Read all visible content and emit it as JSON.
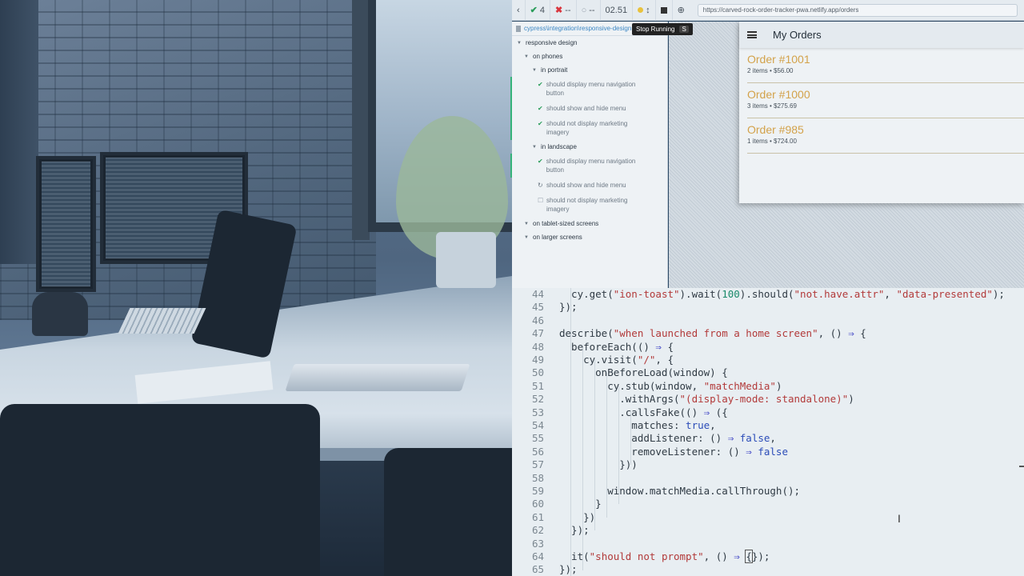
{
  "runner": {
    "passed": "4",
    "failed": "--",
    "pending": "--",
    "duration": "02.51",
    "url": "https://carved-rock-order-tracker-pwa.netlify.app/orders",
    "tooltip": "Stop Running",
    "tooltip_key": "S"
  },
  "reporter": {
    "spec_path": "cypress\\integration\\responsive-design",
    "root": "responsive design",
    "phones": "on phones",
    "portrait": "in portrait",
    "landscape": "in landscape",
    "tests_portrait": [
      "should display menu navigation button",
      "should show and hide menu",
      "should not display marketing imagery"
    ],
    "tests_landscape": [
      "should display menu navigation button",
      "should show and hide menu",
      "should not display marketing imagery"
    ],
    "tablet": "on tablet-sized screens",
    "larger": "on larger screens"
  },
  "app": {
    "title": "My Orders",
    "orders": [
      {
        "name": "Order #1001",
        "detail": "2 items • $56.00"
      },
      {
        "name": "Order #1000",
        "detail": "3 items • $275.69"
      },
      {
        "name": "Order #985",
        "detail": "1 items • $724.00"
      }
    ]
  },
  "editor": {
    "line_numbers": [
      "44",
      "45",
      "46",
      "47",
      "48",
      "49",
      "50",
      "51",
      "52",
      "53",
      "54",
      "55",
      "56",
      "57",
      "58",
      "59",
      "60",
      "61",
      "62",
      "63",
      "64",
      "65"
    ]
  }
}
